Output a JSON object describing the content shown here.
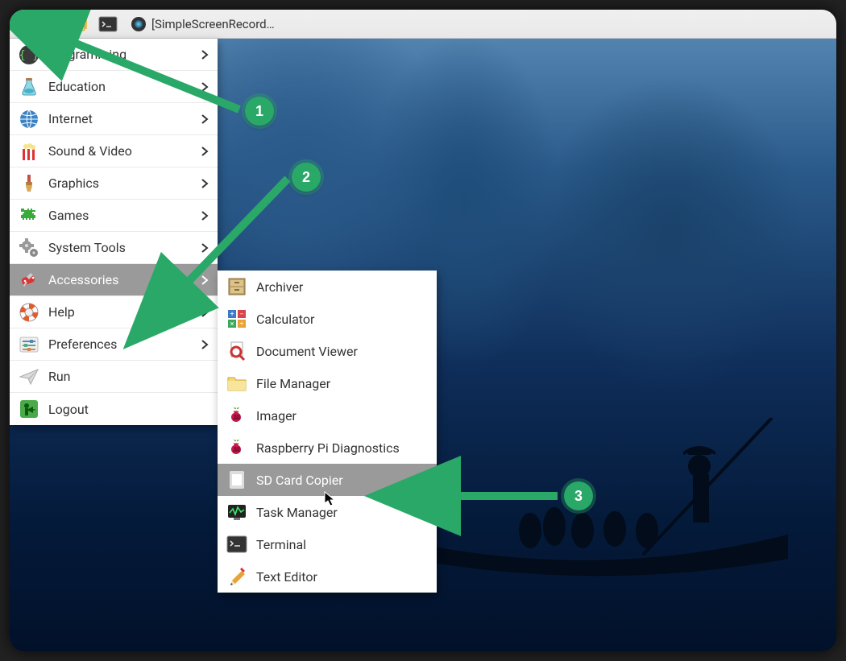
{
  "taskbar": {
    "app_title": "[SimpleScreenRecord…"
  },
  "menu": {
    "items": [
      {
        "label": "Programming",
        "icon": "code-braces-icon",
        "has_sub": true
      },
      {
        "label": "Education",
        "icon": "science-flask-icon",
        "has_sub": true
      },
      {
        "label": "Internet",
        "icon": "globe-icon",
        "has_sub": true
      },
      {
        "label": "Sound & Video",
        "icon": "popcorn-icon",
        "has_sub": true
      },
      {
        "label": "Graphics",
        "icon": "paintbrush-icon",
        "has_sub": true
      },
      {
        "label": "Games",
        "icon": "space-invader-icon",
        "has_sub": true
      },
      {
        "label": "System Tools",
        "icon": "gears-icon",
        "has_sub": true
      },
      {
        "label": "Accessories",
        "icon": "swiss-knife-icon",
        "has_sub": true,
        "selected": true
      },
      {
        "label": "Help",
        "icon": "lifebuoy-icon",
        "has_sub": true
      },
      {
        "label": "Preferences",
        "icon": "sliders-icon",
        "has_sub": true
      },
      {
        "label": "Run",
        "icon": "paperplane-icon",
        "has_sub": false
      },
      {
        "label": "Logout",
        "icon": "exit-icon",
        "has_sub": false
      }
    ]
  },
  "submenu": {
    "items": [
      {
        "label": "Archiver",
        "icon": "cabinet-icon"
      },
      {
        "label": "Calculator",
        "icon": "calculator-icon"
      },
      {
        "label": "Document Viewer",
        "icon": "magnifier-doc-icon"
      },
      {
        "label": "File Manager",
        "icon": "folder-icon"
      },
      {
        "label": "Imager",
        "icon": "raspberry-icon"
      },
      {
        "label": "Raspberry Pi Diagnostics",
        "icon": "raspberry-icon"
      },
      {
        "label": "SD Card Copier",
        "icon": "sdcard-icon",
        "selected": true
      },
      {
        "label": "Task Manager",
        "icon": "monitor-wave-icon"
      },
      {
        "label": "Terminal",
        "icon": "terminal-icon"
      },
      {
        "label": "Text Editor",
        "icon": "pencil-icon"
      }
    ]
  },
  "annotations": {
    "steps": [
      {
        "n": "1"
      },
      {
        "n": "2"
      },
      {
        "n": "3"
      }
    ]
  }
}
